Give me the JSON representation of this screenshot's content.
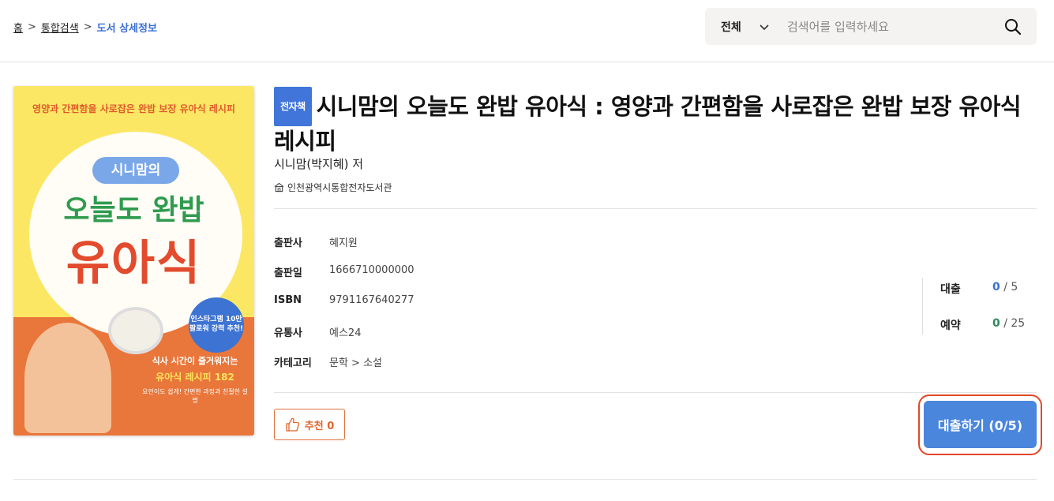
{
  "breadcrumb": {
    "home": "홈",
    "sep": ">",
    "search": "통합검색",
    "current": "도서 상세정보"
  },
  "search": {
    "scope": "전체",
    "placeholder": "검색어를 입력하세요",
    "value": ""
  },
  "cover": {
    "tagline": "영양과 간편함을 사로잡은 완밥 보장 유아식 레시피",
    "brand": "시니맘의",
    "title_line1": "오늘도 완밥",
    "title_line2": "유아식",
    "badge": "인스타그램 10만 팔로워 강력 추천!",
    "line1": "식사 시간이 즐거워지는",
    "line2": "유아식 레시피 182",
    "line3": "요린이도 쉽게! 간편한 과정과 친절한 설명"
  },
  "book": {
    "type_badge": "전자책",
    "title": "시니맘의 오늘도 완밥 유아식 : 영양과 간편함을 사로잡은 완밥 보장 유아식 레시피",
    "author": "시니맘(박지혜) 저",
    "library": "인천광역시통합전자도서관"
  },
  "meta": [
    {
      "label": "출판사",
      "value": "혜지원"
    },
    {
      "label": "출판일",
      "value": "1666710000000"
    },
    {
      "label": "ISBN",
      "value": "9791167640277"
    },
    {
      "label": "유통사",
      "value": "예스24"
    },
    {
      "label": "카테고리",
      "value": "문학 > 소설"
    }
  ],
  "stats": {
    "loan_label": "대출",
    "loan_count": "0",
    "loan_total": " / 5",
    "reserve_label": "예약",
    "reserve_count": "0",
    "reserve_total": " / 25"
  },
  "actions": {
    "recommend_label": "추천 0",
    "borrow_label": "대출하기 (0/5)"
  },
  "colors": {
    "accent": "#4175d9",
    "borrow": "#4a86dc",
    "recommend": "#e0642a",
    "highlight": "#e2472a",
    "loan_count": "#3a6fd6",
    "reserve_count": "#2f8a5e"
  }
}
